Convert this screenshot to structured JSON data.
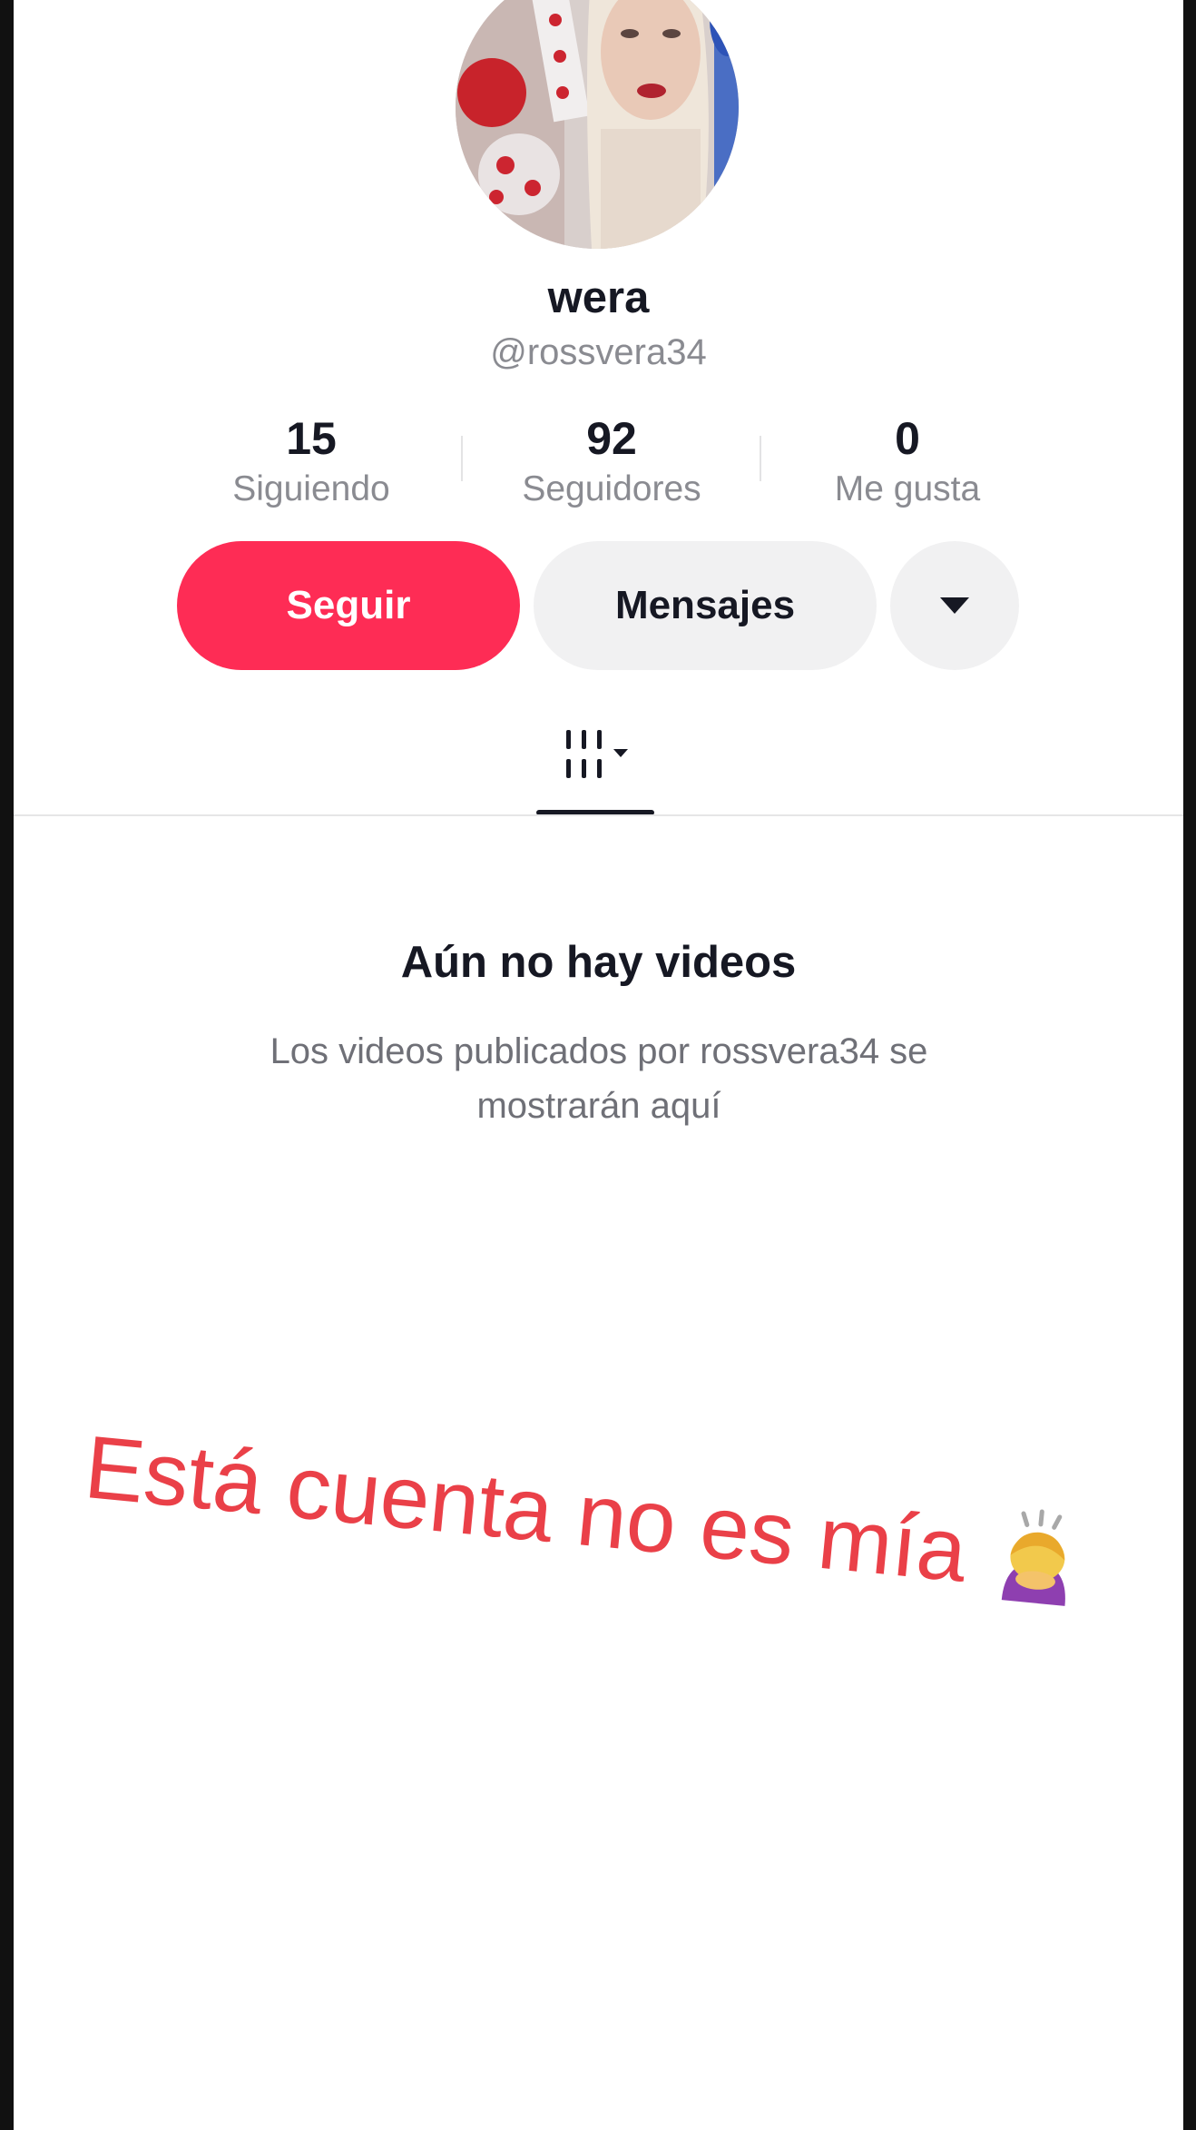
{
  "profile": {
    "display_name": "wera",
    "username": "@rossvera34"
  },
  "stats": [
    {
      "value": "15",
      "label": "Siguiendo"
    },
    {
      "value": "92",
      "label": "Seguidores"
    },
    {
      "value": "0",
      "label": "Me gusta"
    }
  ],
  "actions": {
    "follow_label": "Seguir",
    "message_label": "Mensajes",
    "more_icon": "caret-down-icon"
  },
  "tabs": {
    "active_icon": "videos-grid-icon"
  },
  "empty_state": {
    "title": "Aún no hay videos",
    "subtitle": "Los videos publicados por rossvera34 se mostrarán aquí"
  },
  "overlay": {
    "text": "Está cuenta no es mía",
    "emoji_icon": "person-bowing-icon"
  },
  "colors": {
    "accent": "#fe2c55",
    "overlay_text": "#ea4048",
    "secondary_button": "#f1f1f2"
  }
}
